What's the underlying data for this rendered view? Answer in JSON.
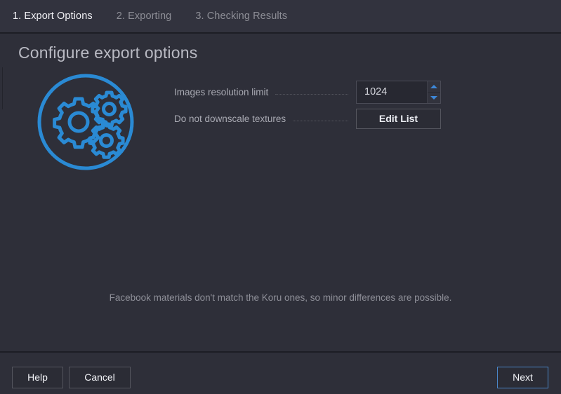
{
  "window": {
    "title": "Configure export options",
    "background": "#2e2f39",
    "accent": "#3d87d8"
  },
  "tabs": [
    {
      "label": "1. Export Options",
      "active": true
    },
    {
      "label": "2. Exporting",
      "active": false
    },
    {
      "label": "3. Checking Results",
      "active": false
    }
  ],
  "illustration": {
    "name": "gears-in-circle-icon",
    "color": "#2a8ad4"
  },
  "form": {
    "rows": [
      {
        "label": "Images resolution limit",
        "control": "spinner",
        "value": "1024",
        "up_icon": "chevron-up-icon",
        "down_icon": "chevron-down-icon"
      },
      {
        "label": "Do not downscale textures",
        "control": "button",
        "value": "Edit List"
      }
    ]
  },
  "note": "Facebook materials don't match the Koru ones, so minor differences are possible.",
  "footer": {
    "help_label": "Help",
    "cancel_label": "Cancel",
    "next_label": "Next"
  }
}
